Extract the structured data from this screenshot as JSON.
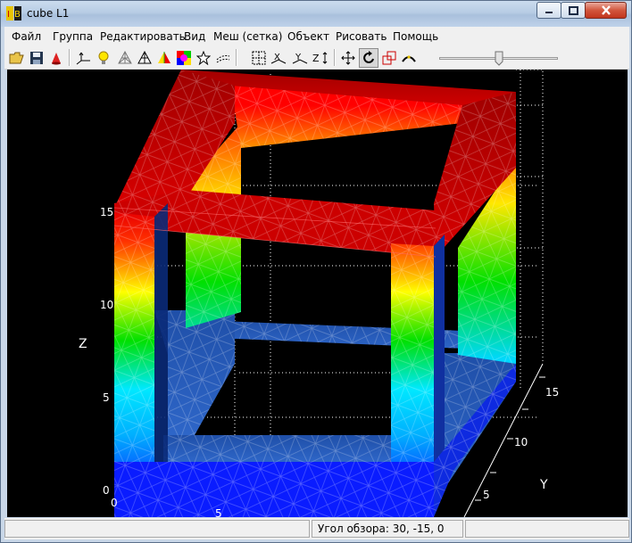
{
  "window": {
    "title": "cube L1",
    "app_icon": "lb-app-icon"
  },
  "menu": [
    "Файл",
    "Группа",
    "Редактировать",
    "Вид",
    "Меш (сетка)",
    "Объект",
    "Рисовать",
    "Помощь"
  ],
  "toolbar": {
    "tools": [
      "open-folder-icon",
      "save-icon",
      "cone-icon",
      "axes-icon",
      "light-bulb-icon",
      "mesh-wireframe-icon",
      "mesh-solid-icon",
      "colored-pyramid-icon",
      "color-palette-icon",
      "star-icon",
      "contour-lines-icon",
      "grid-box-icon",
      "x-axis-icon",
      "y-axis-icon",
      "z-axis-icon",
      "move-icon",
      "rotate-icon",
      "scale-icon",
      "arc-icon"
    ],
    "slider_level": 0.5
  },
  "plot": {
    "axes": {
      "z": {
        "label": "Z",
        "ticks": [
          "0",
          "5",
          "10",
          "15"
        ]
      },
      "y": {
        "label": "Y",
        "ticks": [
          "5",
          "10",
          "15"
        ]
      },
      "x": {
        "ticks": [
          "0",
          "5"
        ]
      }
    },
    "colormap": [
      "#0a1cff",
      "#00e8ff",
      "#00e000",
      "#ffff00",
      "#ff0000"
    ]
  },
  "status": {
    "view_angle": "Угол обзора: 30, -15, 0"
  }
}
